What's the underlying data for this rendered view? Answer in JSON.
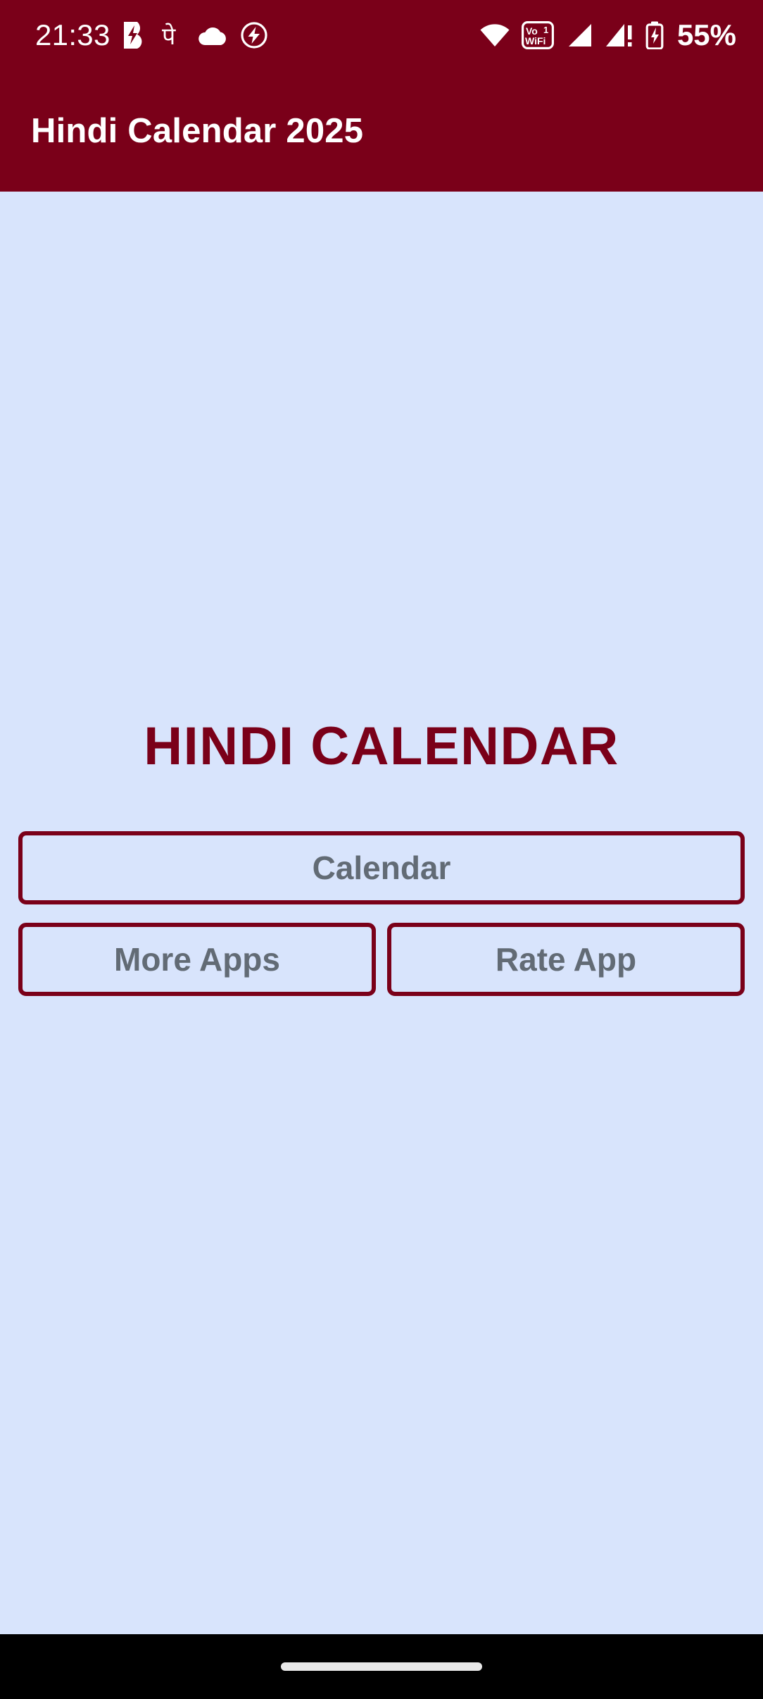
{
  "status_bar": {
    "time": "21:33",
    "battery_percent": "55%",
    "vowifi_label_top": "Vo",
    "vowifi_label_bottom": "WiFi",
    "sim_badge": "1",
    "left_icons": [
      {
        "name": "bolt-app-icon",
        "label": "B"
      },
      {
        "name": "phonepe-icon",
        "label": "पे"
      },
      {
        "name": "cloud-icon",
        "label": "cloud"
      },
      {
        "name": "charging-circle-icon",
        "label": "charging"
      }
    ],
    "right_icons": [
      {
        "name": "wifi-icon",
        "label": "wifi"
      },
      {
        "name": "vowifi-icon",
        "label": "VoWiFi"
      },
      {
        "name": "signal-bars-icon",
        "label": "signal"
      },
      {
        "name": "signal-alert-icon",
        "label": "signal-alert"
      },
      {
        "name": "battery-charging-icon",
        "label": "battery"
      }
    ],
    "colors": {
      "background": "#7A0019",
      "foreground": "#FFFFFF"
    }
  },
  "app_bar": {
    "title": "Hindi Calendar 2025",
    "background": "#7A0019",
    "text_color": "#FFFFFF"
  },
  "main": {
    "heading": "HINDI CALENDAR",
    "heading_color": "#7A0019",
    "background": "#D8E4FC",
    "buttons": {
      "calendar": "Calendar",
      "more_apps": "More Apps",
      "rate_app": "Rate App"
    },
    "button_border_color": "#7A0019",
    "button_text_color": "#626B75"
  },
  "nav_bar": {
    "background": "#000000",
    "gesture_pill_color": "#E8E8E8"
  }
}
